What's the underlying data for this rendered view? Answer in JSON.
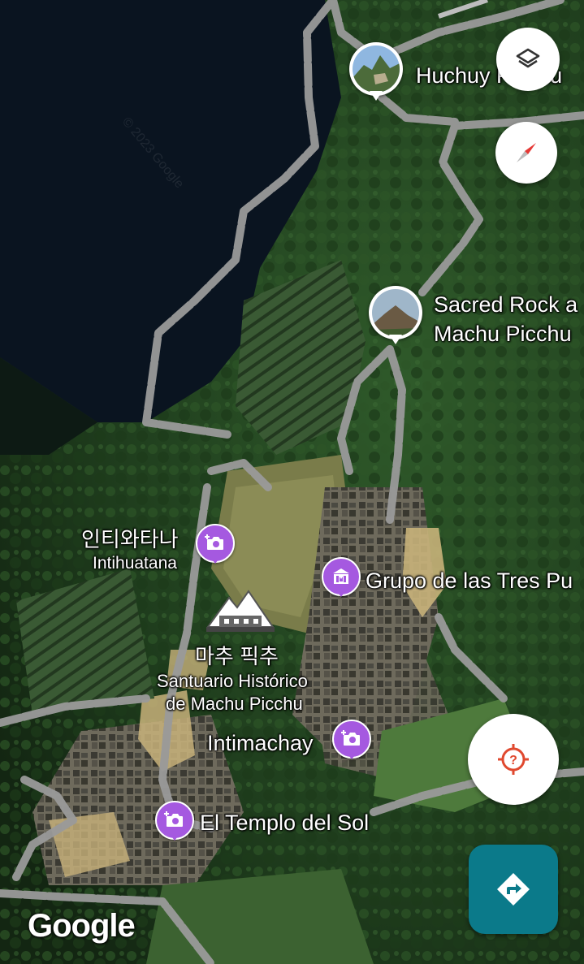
{
  "map": {
    "attribution": "Google",
    "places": [
      {
        "id": "huchuy",
        "name": "Huchuy Picchu",
        "label_visible": "Huchuy Picchu",
        "kind": "photo"
      },
      {
        "id": "sacred_rock",
        "name_line1": "Sacred Rock a",
        "name_line2": "Machu Picchu",
        "kind": "photo"
      },
      {
        "id": "intihuatana",
        "name_local": "인티와타나",
        "name_latin": "Intihuatana",
        "kind": "camera"
      },
      {
        "id": "tres_puertas",
        "name": "Grupo de las Tres Pu",
        "kind": "museum"
      },
      {
        "id": "machu_picchu",
        "name_local": "마추 픽추",
        "name_line1": "Santuario Histórico",
        "name_line2": "de Machu Picchu",
        "kind": "landmark"
      },
      {
        "id": "intimachay",
        "name": "Intimachay",
        "kind": "camera"
      },
      {
        "id": "templo_sol",
        "name": "El Templo del Sol",
        "kind": "camera"
      }
    ]
  },
  "controls": {
    "layers_icon": "layers-icon",
    "compass_icon": "compass-icon",
    "locate_icon": "location-unknown-icon",
    "directions_icon": "directions-icon",
    "accent": "#0b7a8a",
    "pin_color": "#a559e0"
  }
}
